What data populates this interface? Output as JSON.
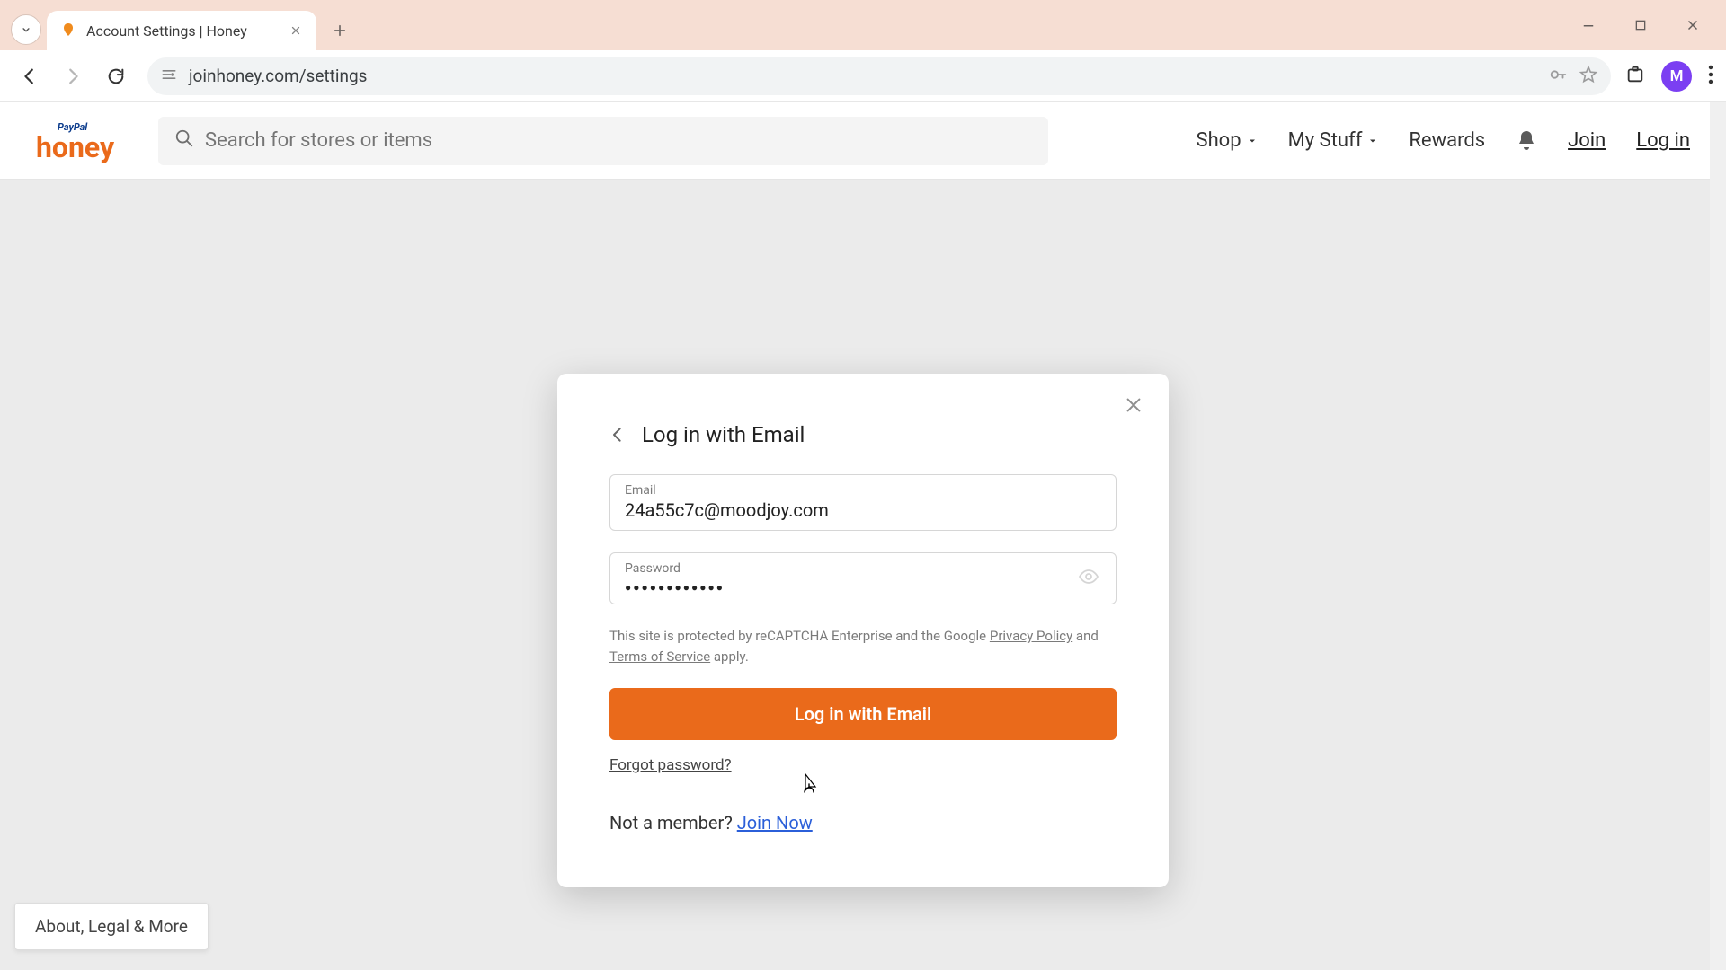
{
  "browser": {
    "tab_title": "Account Settings | Honey",
    "url": "joinhoney.com/settings",
    "avatar_initial": "M"
  },
  "site_header": {
    "search_placeholder": "Search for stores or items",
    "nav": {
      "shop": "Shop",
      "mystuff": "My Stuff",
      "rewards": "Rewards",
      "join": "Join",
      "login": "Log in"
    },
    "logo": {
      "paypal": "PayPal",
      "honey": "honey"
    }
  },
  "modal": {
    "title": "Log in with Email",
    "email_label": "Email",
    "email_value": "24a55c7c@moodjoy.com",
    "password_label": "Password",
    "password_value": "●●●●●●●●●●●●",
    "recaptcha_pre": "This site is protected by reCAPTCHA Enterprise and the Google ",
    "privacy": "Privacy Policy",
    "recaptcha_mid": " and ",
    "tos": "Terms of Service",
    "recaptcha_post": " apply.",
    "submit_label": "Log in with Email",
    "forgot": "Forgot password?",
    "not_member": "Not a member? ",
    "join_now": "Join Now"
  },
  "footer_widget": "About, Legal & More"
}
